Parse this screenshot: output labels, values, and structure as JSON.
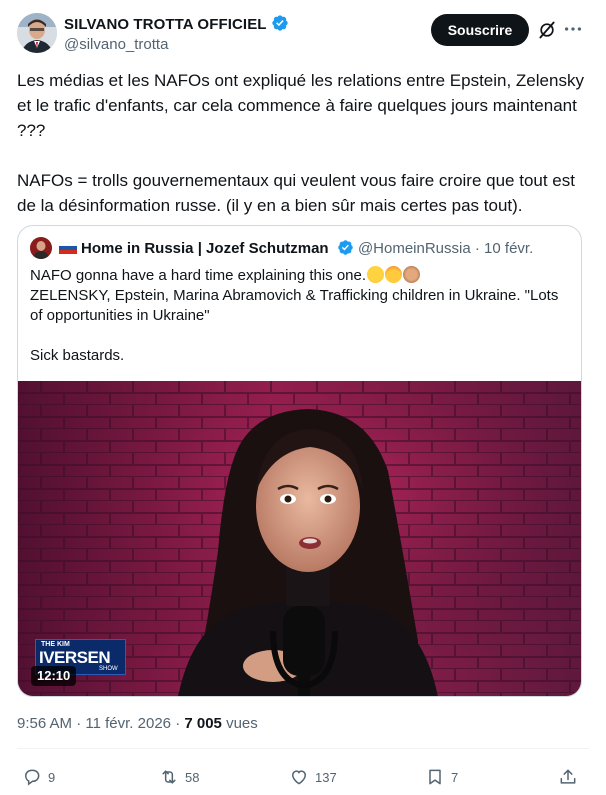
{
  "author": {
    "name": "SILVANO TROTTA OFFICIEL",
    "handle": "@silvano_trotta"
  },
  "header": {
    "subscribe_label": "Souscrire"
  },
  "tweet": {
    "paragraph1": "Les médias et les NAFOs ont expliqué les relations entre Epstein, Zelensky et le trafic d'enfants, car cela commence à faire quelques jours maintenant ???",
    "paragraph2": "NAFOs = trolls gouvernementaux qui veulent vous faire croire que tout est de la désinformation russe. (il y en a bien sûr mais certes pas tout)."
  },
  "quote": {
    "name": "Home in Russia | Jozef Schutzman",
    "handle": "@HomeinRussia",
    "separator": "·",
    "date": "10 févr.",
    "line1": "NAFO gonna have a hard time explaining this one.",
    "line2": "ZELENSKY, Epstein, Marina Abramovich & Trafficking children in Ukraine. \"Lots of opportunities in Ukraine\"",
    "line3": "Sick bastards.",
    "emojis": [
      "astonished-face-emoji",
      "exploding-head-emoji",
      "see-no-evil-monkey-emoji"
    ],
    "video": {
      "duration": "12:10",
      "logo_small": "THE KIM",
      "logo_main": "IVERSEN",
      "logo_sub": "SHOW"
    }
  },
  "footer": {
    "time": "9:56 AM",
    "sep1": "·",
    "date": "11 févr. 2026",
    "sep2": "·",
    "views_count": "7 005",
    "views_label": "vues"
  },
  "actions": {
    "replies": "9",
    "reposts": "58",
    "likes": "137",
    "bookmarks": "7"
  },
  "colors": {
    "verified": "#1d9bf0",
    "text_secondary": "#536471",
    "button": "#0f1419"
  }
}
